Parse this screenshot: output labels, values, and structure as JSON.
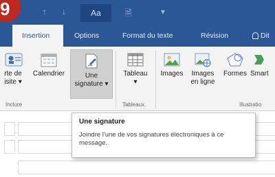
{
  "step_badge": "9",
  "quick_access": {
    "undo_arrow": "↑",
    "redo_arrow": "↓",
    "format_label": "Aa",
    "attach_glyph": "🗎",
    "dropdown_glyph": "▾"
  },
  "tabs": [
    {
      "label": "Insertion",
      "active": true
    },
    {
      "label": "Options"
    },
    {
      "label": "Format du texte"
    },
    {
      "label": "Révision"
    },
    {
      "label": "Dit"
    }
  ],
  "ribbon": {
    "buttons": {
      "carte_de_visite": "rte de\nisite ▾",
      "calendrier": "Calendrier",
      "une_signature": "Une\nsignature ▾",
      "tableau": "Tableau\n▾",
      "images": "Images",
      "images_en_ligne": "Images\nen ligne",
      "formes": "Formes",
      "smartart": "Smart"
    },
    "groups": {
      "inclure": "Inclure",
      "tableaux": "Tableaux",
      "illustrations": "Illustratio"
    }
  },
  "tooltip": {
    "title": "Une signature",
    "body": "Joindre l'une de vos signatures électroniques à ce message."
  },
  "colors": {
    "titlebar": "#2b5797",
    "ribbon": "#f3f3f3",
    "badge": "#c0281f"
  }
}
